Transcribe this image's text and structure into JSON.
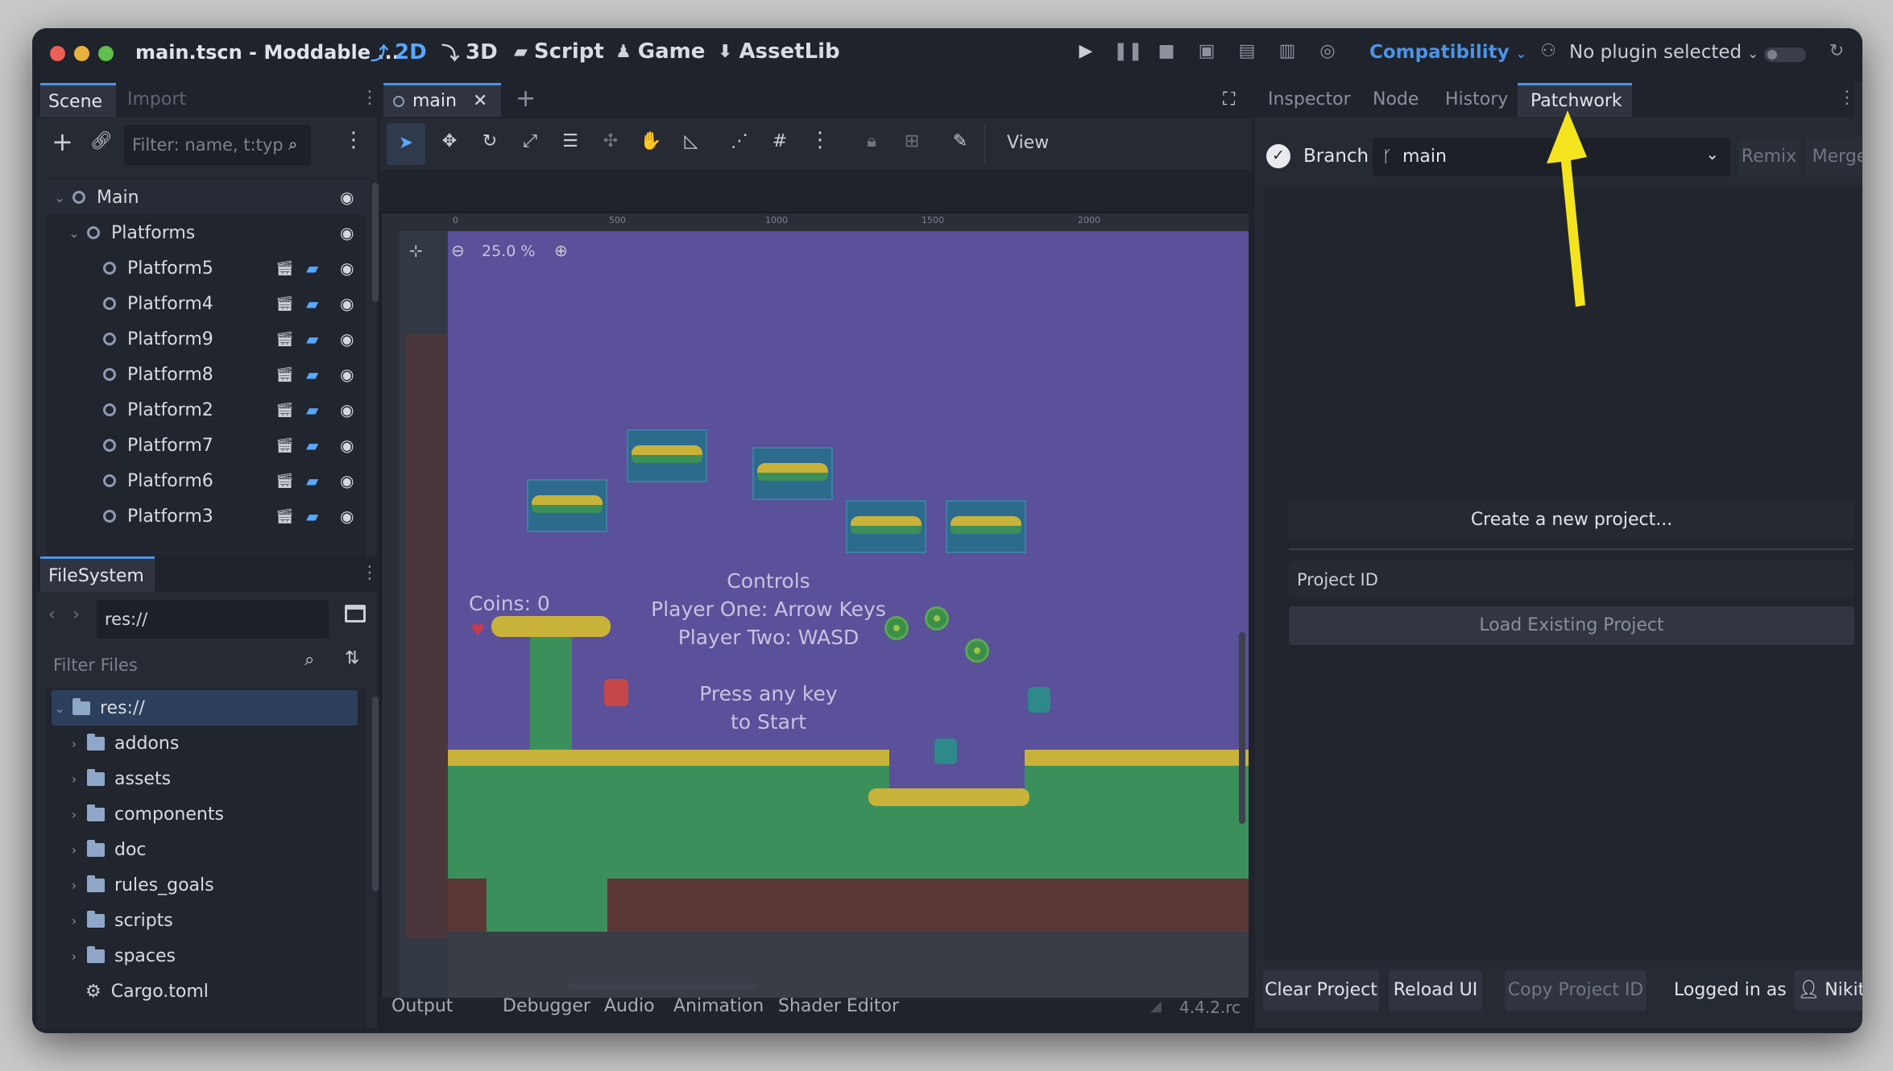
{
  "window": {
    "title": "main.tscn - Moddable ...",
    "traffic_colors": [
      "#ec5f55",
      "#e8b13c",
      "#5fbf4c"
    ]
  },
  "workspaces": [
    {
      "label": "2D",
      "icon": "2d-icon",
      "active": true
    },
    {
      "label": "3D",
      "icon": "3d-icon",
      "active": false
    },
    {
      "label": "Script",
      "icon": "script-icon",
      "active": false
    },
    {
      "label": "Game",
      "icon": "game-icon",
      "active": false
    },
    {
      "label": "AssetLib",
      "icon": "assetlib-icon",
      "active": false
    }
  ],
  "toolbar": {
    "renderer": "Compatibility",
    "plugin": "No plugin selected",
    "accent": "#4c94e8"
  },
  "scene_dock": {
    "tabs": [
      "Scene",
      "Import"
    ],
    "filter_placeholder": "Filter: name, t:typ",
    "tree": [
      {
        "label": "Main",
        "depth": 0,
        "expanded": true
      },
      {
        "label": "Platforms",
        "depth": 1,
        "expanded": true
      },
      {
        "label": "Platform5",
        "depth": 2
      },
      {
        "label": "Platform4",
        "depth": 2
      },
      {
        "label": "Platform9",
        "depth": 2
      },
      {
        "label": "Platform8",
        "depth": 2
      },
      {
        "label": "Platform2",
        "depth": 2
      },
      {
        "label": "Platform7",
        "depth": 2
      },
      {
        "label": "Platform6",
        "depth": 2
      },
      {
        "label": "Platform3",
        "depth": 2
      }
    ]
  },
  "filesystem_dock": {
    "tab": "FileSystem",
    "path": "res://",
    "filter_placeholder": "Filter Files",
    "items": [
      {
        "label": "res://",
        "type": "folder",
        "selected": true
      },
      {
        "label": "addons",
        "type": "folder"
      },
      {
        "label": "assets",
        "type": "folder"
      },
      {
        "label": "components",
        "type": "folder"
      },
      {
        "label": "doc",
        "type": "folder"
      },
      {
        "label": "rules_goals",
        "type": "folder"
      },
      {
        "label": "scripts",
        "type": "folder"
      },
      {
        "label": "spaces",
        "type": "folder"
      },
      {
        "label": "Cargo.toml",
        "type": "file"
      }
    ]
  },
  "editor": {
    "tab": "main",
    "view_menu": "View",
    "zoom": "25.0 %",
    "ruler_ticks": [
      "0",
      "500",
      "1000",
      "1500",
      "2000"
    ],
    "scene_text": {
      "coins": "Coins: 0",
      "controls_title": "Controls",
      "player_one": "Player One: Arrow Keys",
      "player_two": "Player Two: WASD",
      "press_line1": "Press any key",
      "press_line2": "to Start"
    },
    "bottom_tabs": [
      "Output",
      "Debugger",
      "Audio",
      "Animation",
      "Shader Editor"
    ],
    "version": "4.4.2.rc"
  },
  "inspector_dock": {
    "tabs": [
      "Inspector",
      "Node",
      "History",
      "Patchwork"
    ],
    "active_tab": "Patchwork",
    "branch_label": "Branch",
    "branch_value": "main",
    "remix": "Remix",
    "merge": "Merge",
    "create_project": "Create a new project...",
    "project_id_placeholder": "Project ID",
    "load_project": "Load Existing Project",
    "footer": {
      "clear": "Clear Project",
      "reload": "Reload UI",
      "copy": "Copy Project ID",
      "logged_in": "Logged in as",
      "user": "Nikita"
    }
  },
  "annotation": {
    "arrow_color": "#f4e41f"
  }
}
